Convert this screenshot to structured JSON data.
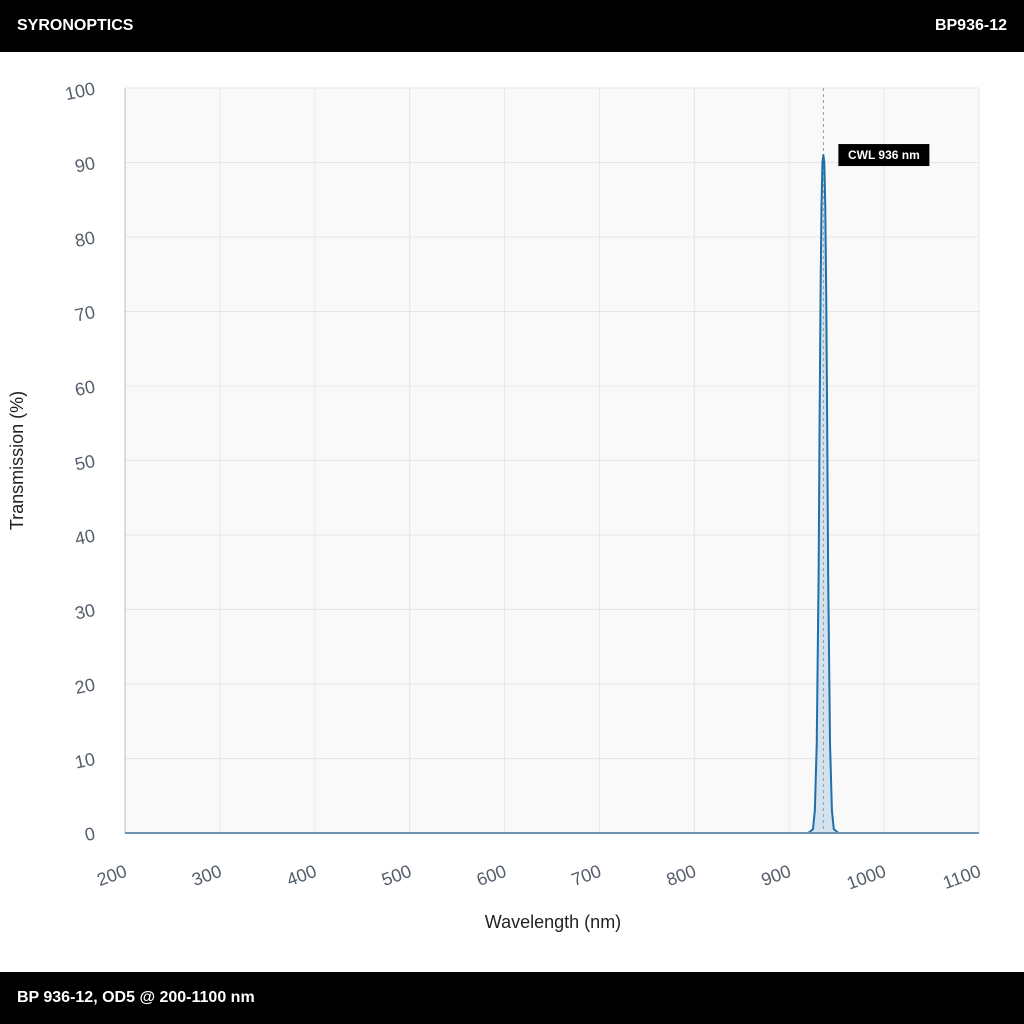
{
  "header": {
    "brand": "SYRONOPTICS",
    "part_number": "BP936-12"
  },
  "footer": {
    "caption": "BP 936-12, OD5 @ 200-1100 nm"
  },
  "colors": {
    "curve": "#1f6fa8",
    "fill": "#c8dcec",
    "plot_bg": "#f9f9fa",
    "grid": "#e6e6e9",
    "bar": "#000000"
  },
  "chart_data": {
    "type": "line",
    "title": "",
    "xlabel": "Wavelength (nm)",
    "ylabel": "Transmission (%)",
    "xlim": [
      200,
      1100
    ],
    "ylim": [
      0,
      100
    ],
    "x_ticks": [
      200,
      300,
      400,
      500,
      600,
      700,
      800,
      900,
      1000,
      1100
    ],
    "y_ticks": [
      0,
      10,
      20,
      30,
      40,
      50,
      60,
      70,
      80,
      90,
      100
    ],
    "grid": true,
    "series": [
      {
        "x": [
          200,
          920,
          925,
          927,
          929,
          931,
          932,
          933,
          934,
          935,
          936,
          937,
          938,
          939,
          940,
          941,
          943,
          945,
          947,
          952,
          1100
        ],
        "y": [
          0,
          0,
          0.5,
          3,
          12,
          35,
          55,
          72,
          84,
          90,
          91,
          90,
          84,
          72,
          55,
          35,
          12,
          3,
          0.5,
          0,
          0
        ]
      }
    ],
    "annotation": {
      "x": 936,
      "label": "CWL 936 nm"
    }
  }
}
